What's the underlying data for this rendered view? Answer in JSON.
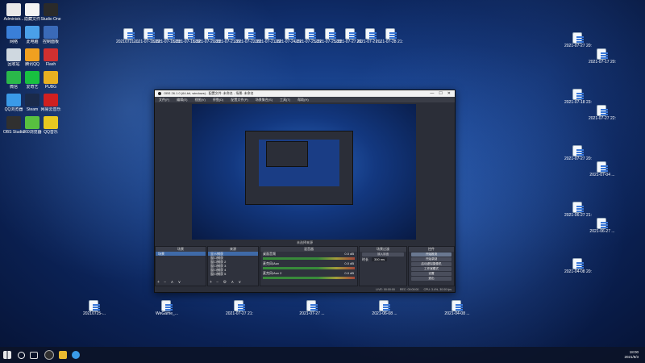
{
  "desktop": {
    "left_icons": [
      {
        "label": "Administr...",
        "color": "#e8e8e8"
      },
      {
        "label": "隐藏文件",
        "color": "#f4f4f4"
      },
      {
        "label": "Studio One",
        "color": "#2a2a2a"
      },
      {
        "label": "网络",
        "color": "#3a7fd8"
      },
      {
        "label": "此电脑",
        "color": "#4aa0e8"
      },
      {
        "label": "控制面板",
        "color": "#3a6ab8"
      },
      {
        "label": "回收站",
        "color": "#cfd8e0"
      },
      {
        "label": "腾讯QQ",
        "color": "#f0a020"
      },
      {
        "label": "Flash",
        "color": "#d03030"
      },
      {
        "label": "微信",
        "color": "#2ab84a"
      },
      {
        "label": "爱奇艺",
        "color": "#18c040"
      },
      {
        "label": "PUBG",
        "color": "#e8b020"
      },
      {
        "label": "QQ浏览器",
        "color": "#3a9ae8"
      },
      {
        "label": "Steam",
        "color": "#1a2a4a"
      },
      {
        "label": "网易云音乐",
        "color": "#d02020"
      },
      {
        "label": "OBS Studio",
        "color": "#303030"
      },
      {
        "label": "360浏览器",
        "color": "#58c040"
      },
      {
        "label": "QQ音乐",
        "color": "#e8c820"
      }
    ],
    "top_files": [
      "20210721-...",
      "2021-07-18 22:01:...",
      "2021-07-18 23:17:44...",
      "2021-07-18 22:17:...",
      "2021-07-20 23:24:...",
      "2021-07-21 21:14:...",
      "2021-07-22 20:49:...",
      "2021-07-21 22:17:...",
      "2021-07-24 21:32:...",
      "2021-07-25 21:10:...",
      "2021-07-25 23:27:...",
      "2021-07-27 22:14:...",
      "2021-07-27 ...",
      "2021-07-28 21:..."
    ],
    "right_files": [
      "2021-07-27 20:52:...",
      "2021-07-17 20:06:...",
      "2021-07-18 23:36:...",
      "2021-07-27 22:14:...",
      "2021-07-27 20:22:...",
      "2021-07-04 ...",
      "2021-06-27 21:09:...",
      "2021-06-27 ...",
      "2021-04-08 20:42:..."
    ],
    "bottom_files": [
      "20210725-...",
      "WeGame_...",
      "2021-07-27 21:...",
      "2021-07-27 ...",
      "2021-06-08 ...",
      "2021-04-08 ..."
    ]
  },
  "obs": {
    "title": "OBS 26.1.0 (64-bit, windows) - 配置文件: 未命名 - 场景: 未命名",
    "window_controls": {
      "min": "—",
      "max": "☐",
      "close": "✕"
    },
    "menu": [
      "文件(F)",
      "编辑(E)",
      "视图(V)",
      "停靠(D)",
      "配置文件(P)",
      "场景集合(S)",
      "工具(T)",
      "帮助(H)"
    ],
    "scene_label": "未选择来源",
    "docks": {
      "scenes": {
        "title": "场景",
        "items": [
          "场景"
        ]
      },
      "sources": {
        "title": "来源",
        "items": [
          "显示捕获",
          "窗口捕获",
          "窗口捕获 2",
          "窗口捕获 3",
          "窗口捕获 4",
          "窗口捕获 5"
        ]
      },
      "mixer": {
        "title": "混音器",
        "channels": [
          {
            "name": "桌面音频",
            "level": "0.0 dB"
          },
          {
            "name": "麦克风/Aux",
            "level": "0.0 dB"
          },
          {
            "name": "麦克风/Aux 2",
            "level": "0.0 dB"
          }
        ]
      },
      "transitions": {
        "title": "场景过渡",
        "type": "淡入淡出",
        "duration_label": "时长",
        "duration": "300 ms"
      },
      "controls": {
        "title": "控件",
        "buttons": [
          "开始推流",
          "开始录制",
          "启动虚拟摄像机",
          "工作室模式",
          "设置",
          "退出"
        ]
      }
    },
    "status": {
      "live": "LIVE: 00:00:00",
      "rec": "REC: 00:00:00",
      "cpu": "CPU: 3.4%, 30.00 fps"
    }
  },
  "taskbar": {
    "time": "18:00",
    "date": "2021/8/3"
  },
  "colors": {
    "accent": "#3f6aa8",
    "desktop_dark": "#061335"
  }
}
